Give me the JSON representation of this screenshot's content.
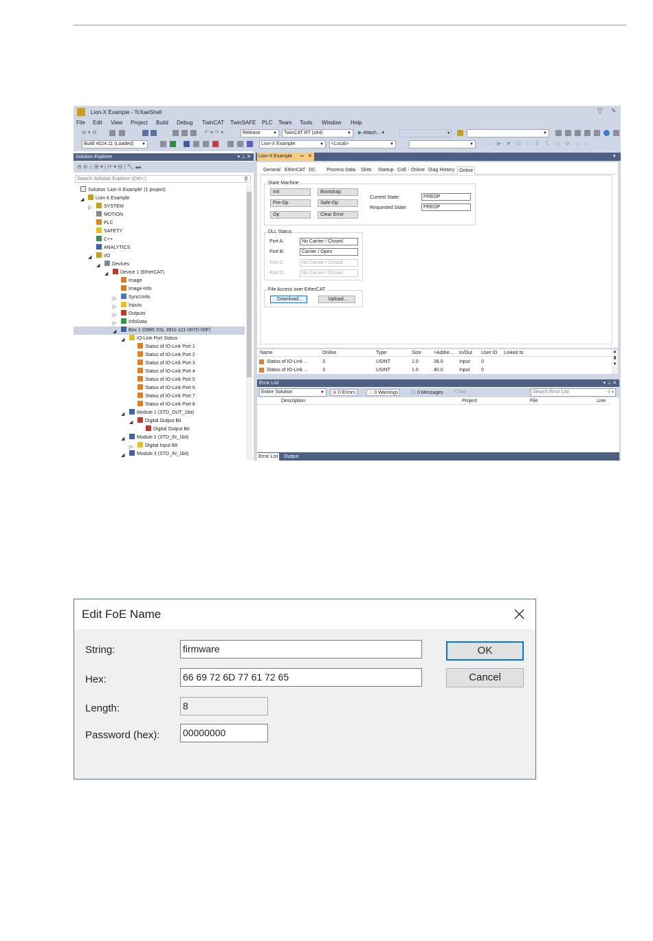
{
  "ide": {
    "window_title": "Lion-X Example - TcXaeShell",
    "menu": [
      "File",
      "Edit",
      "View",
      "Project",
      "Build",
      "Debug",
      "TwinCAT",
      "TwinSAFE",
      "PLC",
      "Team",
      "Tools",
      "Window",
      "Help"
    ],
    "toolbar": {
      "config": "Release",
      "platform": "TwinCAT RT (x64)",
      "attach": "Attach...",
      "build": "Build 4024.11 (Loaded)",
      "project": "Lion-X Example",
      "target": "<Local>"
    },
    "solution_explorer": {
      "title": "Solution Explorer",
      "search_placeholder": "Search Solution Explorer (Ctrl+;)",
      "items": [
        "Solution 'Lion-X Example' (1 project)",
        "Lion-X Example",
        "SYSTEM",
        "MOTION",
        "PLC",
        "SAFETY",
        "C++",
        "ANALYTICS",
        "I/O",
        "Devices",
        "Device 1 (EtherCAT)",
        "Image",
        "Image-Info",
        "SyncUnits",
        "Inputs",
        "Outputs",
        "InfoData",
        "Box 1 (0980 XSL 3911-121-007D-00F)",
        "IO-Link Port Status",
        "Status of IO-Link Port 1",
        "Status of IO-Link Port 2",
        "Status of IO-Link Port 3",
        "Status of IO-Link Port 4",
        "Status of IO-Link Port 5",
        "Status of IO-Link Port 6",
        "Status of IO-Link Port 7",
        "Status of IO-Link Port 8",
        "Module 1 (STD_OUT_1bit)",
        "Digital Output Bit",
        "Digital Output Bit",
        "Module 2 (STD_IN_1bit)",
        "Digital Input Bit",
        "Module 3 (STD_IN_1bit)"
      ]
    },
    "doc_tab": "Lion-X Example",
    "tabs": [
      "General",
      "EtherCAT",
      "DC",
      "Process Data",
      "Slots",
      "Startup",
      "CoE - Online",
      "Diag History",
      "Online"
    ],
    "state_machine": {
      "title": "State Machine",
      "buttons": [
        "Init",
        "Bootstrap",
        "Pre-Op",
        "Safe-Op",
        "Op",
        "Clear Error"
      ],
      "current_label": "Current State:",
      "current_value": "PREOP",
      "requested_label": "Requested State:",
      "requested_value": "PREOP"
    },
    "dll_status": {
      "title": "DLL Status",
      "ports": [
        {
          "label": "Port A:",
          "value": "No Carrier / Closed"
        },
        {
          "label": "Port B:",
          "value": "Carrier / Open"
        },
        {
          "label": "Port C:",
          "value": "No Carrier / Closed"
        },
        {
          "label": "Port D:",
          "value": "No Carrier / Closed"
        }
      ]
    },
    "file_access": {
      "title": "File Access over EtherCAT",
      "download": "Download...",
      "upload": "Upload..."
    },
    "var_table": {
      "headers": [
        "Name",
        "Online",
        "Type",
        "Size",
        ">Addre...",
        "In/Out",
        "User ID",
        "Linked to"
      ],
      "rows": [
        [
          "Status of IO-Link ...",
          "3",
          "USINT",
          "1.0",
          "39.0",
          "Input",
          "0",
          ""
        ],
        [
          "Status of IO-Link ...",
          "3",
          "USINT",
          "1.0",
          "40.0",
          "Input",
          "0",
          ""
        ]
      ]
    },
    "error_list": {
      "title": "Error List",
      "scope": "Entire Solution",
      "errors": "0 Errors",
      "warnings": "0 Warnings",
      "messages": "0 Messages",
      "clear": "Clear",
      "search_placeholder": "Search Error List",
      "headers": [
        "Description",
        "Project",
        "File",
        "Line"
      ],
      "bottom_tabs": [
        "Error List",
        "Output"
      ]
    }
  },
  "dialog": {
    "title": "Edit FoE Name",
    "string_label": "String:",
    "string_value": "firmware",
    "hex_label": "Hex:",
    "hex_value": "66 69 72 6D 77 61 72 65",
    "length_label": "Length:",
    "length_value": "8",
    "password_label": "Password (hex):",
    "password_value": "00000000",
    "ok": "OK",
    "cancel": "Cancel"
  }
}
